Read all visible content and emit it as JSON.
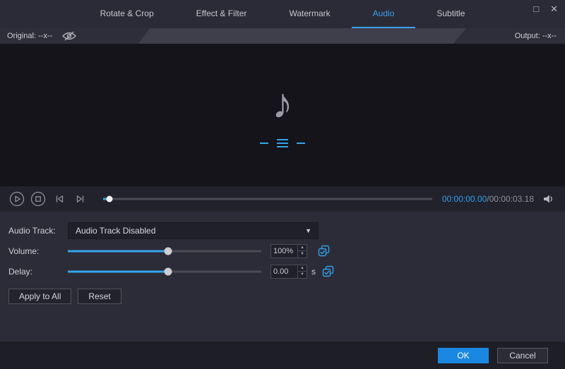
{
  "window_controls": {
    "maximize_icon": "□",
    "close_icon": "✕"
  },
  "tabs": [
    {
      "label": "Rotate & Crop",
      "active": false
    },
    {
      "label": "Effect & Filter",
      "active": false
    },
    {
      "label": "Watermark",
      "active": false
    },
    {
      "label": "Audio",
      "active": true
    },
    {
      "label": "Subtitle",
      "active": false
    }
  ],
  "preview_bar": {
    "original_label": "Original: --x--",
    "output_label": "Output: --x--"
  },
  "preview": {
    "placeholder_icon": "music-note",
    "music_note_glyph": "♪"
  },
  "player": {
    "time_current": "00:00:00.00",
    "time_separator": "/",
    "time_total": "00:00:03.18",
    "progress_percent": 2
  },
  "audio_panel": {
    "track_label": "Audio Track:",
    "track_value": "Audio Track Disabled",
    "volume_label": "Volume:",
    "volume_value": "100%",
    "volume_slider_percent": 52,
    "delay_label": "Delay:",
    "delay_value": "0.00",
    "delay_unit": "s",
    "delay_slider_percent": 52,
    "apply_all_label": "Apply to All",
    "reset_label": "Reset"
  },
  "footer": {
    "ok_label": "OK",
    "cancel_label": "Cancel"
  },
  "icons": {
    "dropdown_arrow": "▼",
    "spin_up": "▲",
    "spin_down": "▼"
  },
  "colors": {
    "accent": "#2f9fe8",
    "active_tab": "#3b9ff0"
  }
}
